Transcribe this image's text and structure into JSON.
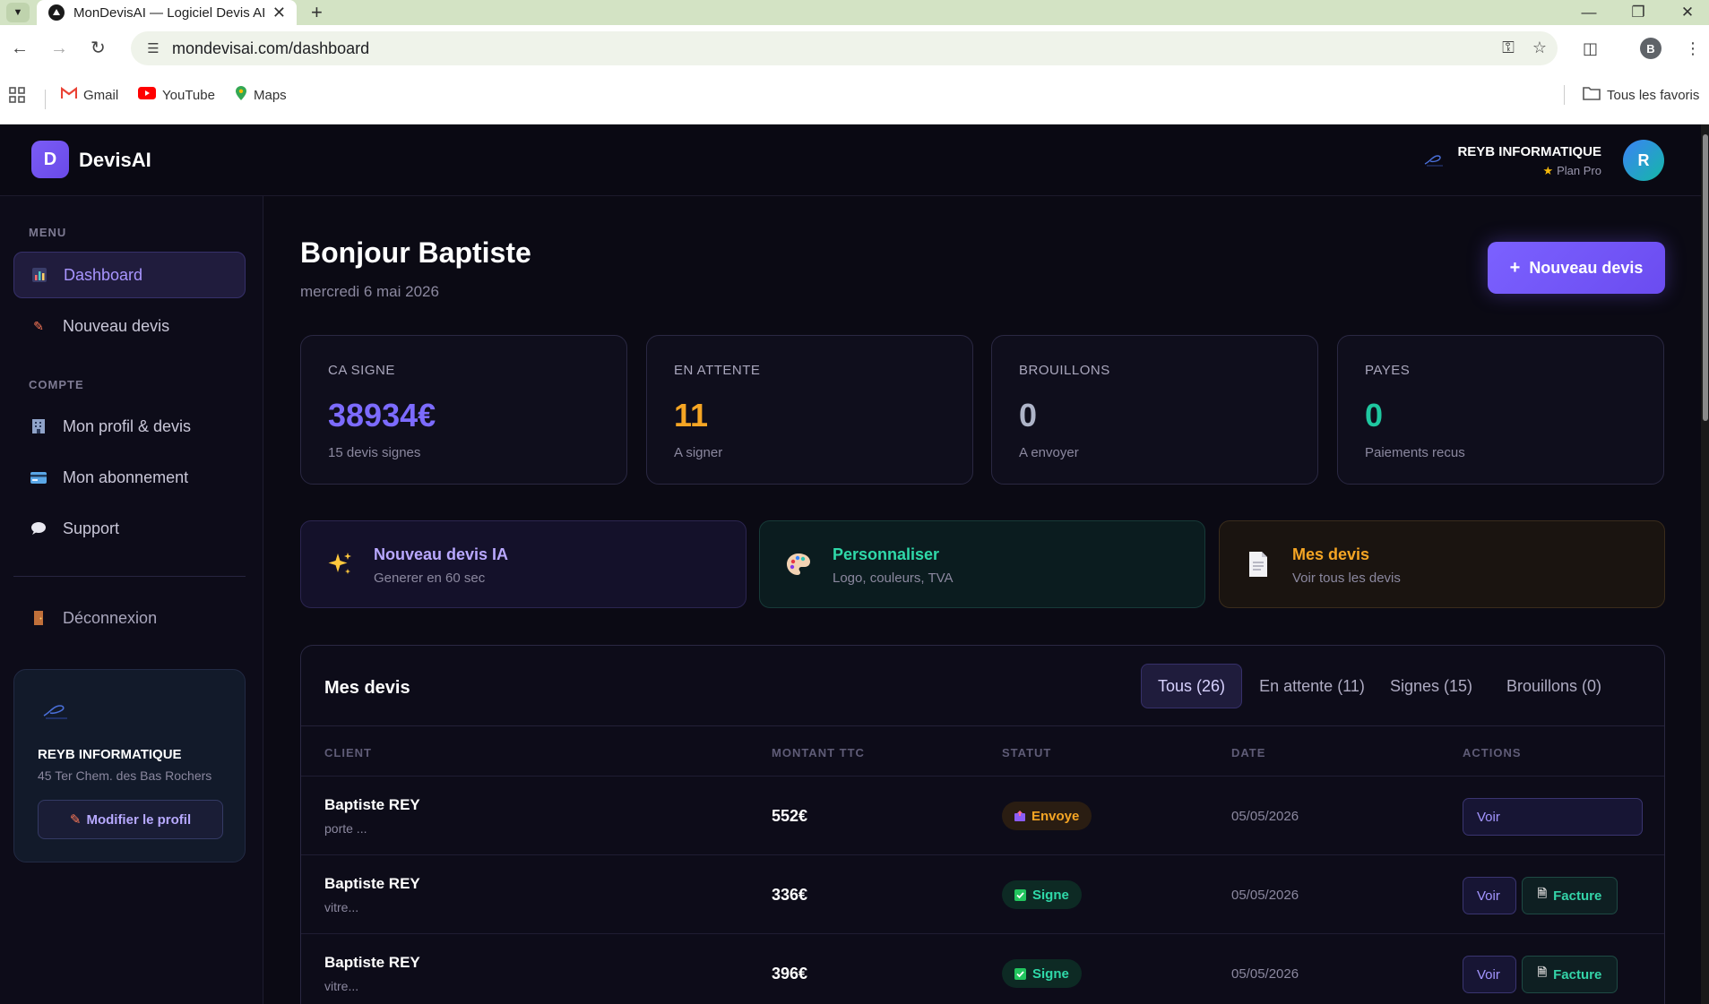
{
  "browser": {
    "tab_title": "MonDevisAI — Logiciel Devis AI",
    "url": "mondevisai.com/dashboard",
    "profile_initial": "B",
    "bookmarks": [
      "Gmail",
      "YouTube",
      "Maps"
    ],
    "all_bookmarks": "Tous les favoris"
  },
  "header": {
    "brand_initial": "D",
    "brand": "DevisAI",
    "company": "REYB INFORMATIQUE",
    "plan": "Plan Pro",
    "avatar_initial": "R"
  },
  "sidebar": {
    "section_menu": "MENU",
    "section_account": "COMPTE",
    "items": [
      {
        "label": "Dashboard",
        "icon": "bar-chart-icon"
      },
      {
        "label": "Nouveau devis",
        "icon": "pencil-icon"
      },
      {
        "label": "Mon profil & devis",
        "icon": "building-icon"
      },
      {
        "label": "Mon abonnement",
        "icon": "credit-card-icon"
      },
      {
        "label": "Support",
        "icon": "speech-bubble-icon"
      },
      {
        "label": "Déconnexion",
        "icon": "door-icon"
      }
    ],
    "card": {
      "company": "REYB INFORMATIQUE",
      "address": "45 Ter Chem. des Bas Rochers",
      "edit_button": "Modifier le profil"
    }
  },
  "main": {
    "greeting": "Bonjour Baptiste",
    "date": "mercredi 6 mai 2026",
    "new_quote_button": "Nouveau devis",
    "stats": [
      {
        "label": "CA SIGNE",
        "value": "38934€",
        "sub": "15 devis signes",
        "color": "#7c6bff"
      },
      {
        "label": "EN ATTENTE",
        "value": "11",
        "sub": "A signer",
        "color": "#f5a524"
      },
      {
        "label": "BROUILLONS",
        "value": "0",
        "sub": "A envoyer",
        "color": "#aeb4c8"
      },
      {
        "label": "PAYES",
        "value": "0",
        "sub": "Paiements recus",
        "color": "#1fc7a0"
      }
    ],
    "actions": [
      {
        "title": "Nouveau devis IA",
        "sub": "Generer en 60 sec",
        "icon": "sparkles-icon",
        "color": "#b9a8ff"
      },
      {
        "title": "Personnaliser",
        "sub": "Logo, couleurs, TVA",
        "icon": "palette-icon",
        "color": "#2fd9a9"
      },
      {
        "title": "Mes devis",
        "sub": "Voir tous les devis",
        "icon": "document-icon",
        "color": "#f5a524"
      }
    ],
    "quotes": {
      "title": "Mes devis",
      "filters": [
        "Tous (26)",
        "En attente (11)",
        "Signes (15)",
        "Brouillons (0)"
      ],
      "columns": [
        "CLIENT",
        "MONTANT TTC",
        "STATUT",
        "DATE",
        "ACTIONS"
      ],
      "view_label": "Voir",
      "invoice_label": "Facture",
      "rows": [
        {
          "client": "Baptiste REY",
          "desc": "porte ...",
          "amount": "552€",
          "status": "Envoye",
          "date": "05/05/2026"
        },
        {
          "client": "Baptiste REY",
          "desc": "vitre...",
          "amount": "336€",
          "status": "Signe",
          "date": "05/05/2026"
        },
        {
          "client": "Baptiste REY",
          "desc": "vitre...",
          "amount": "396€",
          "status": "Signe",
          "date": "05/05/2026"
        }
      ]
    }
  }
}
